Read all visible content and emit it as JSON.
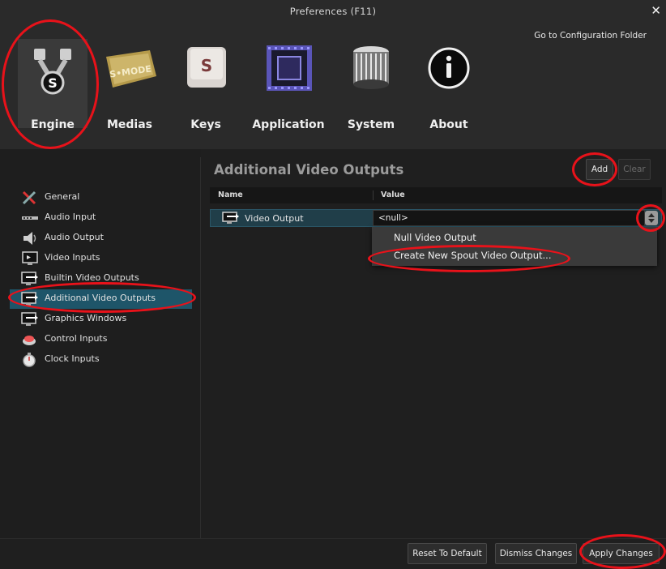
{
  "window": {
    "title": "Preferences (F11)"
  },
  "header": {
    "config_link": "Go to Configuration Folder"
  },
  "categories": [
    {
      "label": "Engine",
      "icon": "engine-pistons-icon",
      "active": true
    },
    {
      "label": "Medias",
      "icon": "media-ticket-icon"
    },
    {
      "label": "Keys",
      "icon": "keyboard-key-icon"
    },
    {
      "label": "Application",
      "icon": "chip-icon"
    },
    {
      "label": "System",
      "icon": "heatsink-icon"
    },
    {
      "label": "About",
      "icon": "info-icon"
    }
  ],
  "sidebar": {
    "items": [
      {
        "label": "General",
        "icon": "tools-icon"
      },
      {
        "label": "Audio Input",
        "icon": "audio-input-icon"
      },
      {
        "label": "Audio Output",
        "icon": "speaker-icon"
      },
      {
        "label": "Video Inputs",
        "icon": "video-input-icon"
      },
      {
        "label": "Builtin Video Outputs",
        "icon": "monitor-output-icon"
      },
      {
        "label": "Additional Video Outputs",
        "icon": "monitor-output-icon",
        "selected": true
      },
      {
        "label": "Graphics Windows",
        "icon": "graphics-window-icon"
      },
      {
        "label": "Control Inputs",
        "icon": "control-input-icon"
      },
      {
        "label": "Clock Inputs",
        "icon": "stopwatch-icon"
      }
    ]
  },
  "main": {
    "title": "Additional Video Outputs",
    "add_label": "Add",
    "clear_label": "Clear",
    "columns": {
      "name": "Name",
      "value": "Value"
    },
    "row": {
      "name": "Video Output",
      "value": "<null>"
    },
    "dropdown_options": [
      "Null Video Output",
      "Create New Spout Video Output..."
    ]
  },
  "footer": {
    "reset_label": "Reset To Default",
    "dismiss_label": "Dismiss Changes",
    "apply_label": "Apply Changes"
  },
  "colors": {
    "selection": "#1e5569",
    "annotation": "#e8121a",
    "background": "#1f1f1f"
  }
}
